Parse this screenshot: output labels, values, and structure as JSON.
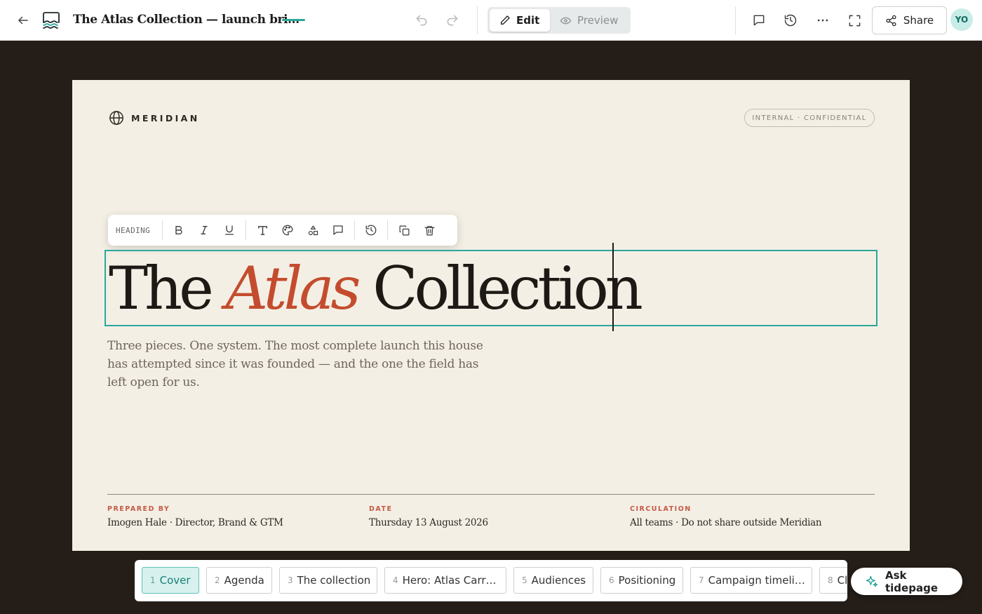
{
  "document": {
    "title": "The Atlas Collection — launch bri…"
  },
  "mode": {
    "edit_label": "Edit",
    "preview_label": "Preview",
    "active": "edit"
  },
  "toolbar": {
    "share_label": "Share",
    "avatar_initials": "YO",
    "accent_color": "#2aa79b"
  },
  "slide": {
    "brand_name": "MERIDIAN",
    "confidential_badge": "INTERNAL · CONFIDENTIAL",
    "format_toolbar": {
      "element_label": "HEADING"
    },
    "heading": {
      "part1": "The ",
      "part2": "Atlas",
      "part3": " Collection",
      "accent_color": "#c44c2e"
    },
    "subtitle": "Three pieces. One system. The most complete launch this house has attempted since it was founded — and the one the field has left open for us.",
    "meta": [
      {
        "label": "PREPARED BY",
        "value": "Imogen Hale · Director, Brand & GTM"
      },
      {
        "label": "DATE",
        "value": "Thursday 13 August 2026"
      },
      {
        "label": "CIRCULATION",
        "value": "All teams · Do not share outside Meridian"
      }
    ]
  },
  "slides_strip": [
    {
      "num": "1",
      "label": "Cover",
      "active": true
    },
    {
      "num": "2",
      "label": "Agenda"
    },
    {
      "num": "3",
      "label": "The collection"
    },
    {
      "num": "4",
      "label": "Hero: Atlas Carr…"
    },
    {
      "num": "5",
      "label": "Audiences"
    },
    {
      "num": "6",
      "label": "Positioning"
    },
    {
      "num": "7",
      "label": "Campaign timeli…"
    },
    {
      "num": "8",
      "label": "Cl"
    }
  ],
  "ask_button": {
    "label": "Ask tidepage"
  }
}
